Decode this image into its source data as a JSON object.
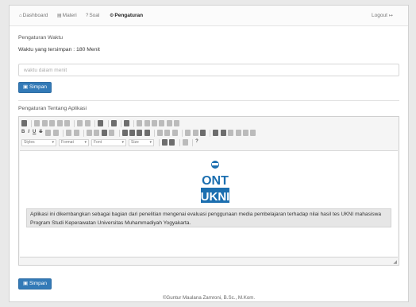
{
  "nav": {
    "items": [
      {
        "icon": "home-icon",
        "label": "Dashboard"
      },
      {
        "icon": "book-icon",
        "label": "Materi"
      },
      {
        "icon": "question-icon",
        "label": "Soal"
      },
      {
        "icon": "gears-icon",
        "label": "Pengaturan"
      }
    ],
    "logout": "Logout"
  },
  "time_section": {
    "title": "Pengaturan Waktu",
    "saved_text": "Waktu yang tersimpan : 180 Menit",
    "input_placeholder": "waktu dalam menit",
    "save_label": "Simpan"
  },
  "about_section": {
    "title": "Pengaturan Tentang Aplikasi",
    "toolbar": {
      "styles": "Styles",
      "format": "Format",
      "font": "Font",
      "size": "Size"
    },
    "logo_top": "ONT",
    "logo_bottom": "UKNI",
    "body_text": "Aplikasi ini dikembangkan sebagai bagian dari penelitian mengenai evaluasi penggunaan media pembelajaran terhadap nilai hasil tes UKNI mahasiswa Program Studi Keperawatan Universitas Muhammadiyah Yogyakarta.",
    "save_label": "Simpan"
  },
  "footer": "©Guntur Maulana Zamroni, B.Sc., M.Kom.",
  "colors": {
    "primary": "#337ab7",
    "logo_blue": "#1c6fb0"
  }
}
